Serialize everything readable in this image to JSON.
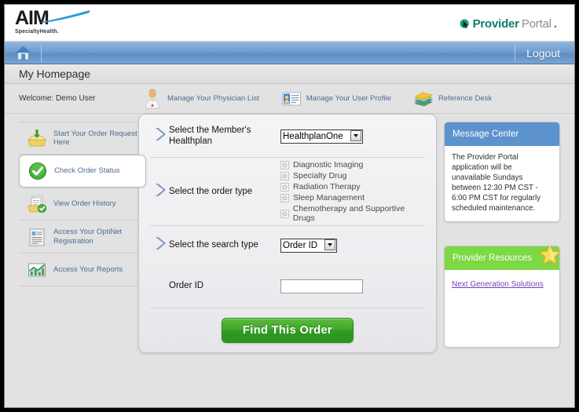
{
  "header": {
    "logo_main": "AIM",
    "logo_sub": "SpecialtyHealth.",
    "portal_brand_1": "Provider",
    "portal_brand_2": "Portal",
    "portal_brand_dot": ".",
    "cursor_icon": "cursor-arrow-icon"
  },
  "nav": {
    "home_icon": "home-icon",
    "logout_label": "Logout"
  },
  "breadcrumb": {
    "title": "My Homepage"
  },
  "welcome": {
    "greeting": "Welcome: Demo User",
    "quicklinks": [
      {
        "label": "Manage Your Physician List",
        "icon": "physician-icon"
      },
      {
        "label": "Manage Your User Profile",
        "icon": "id-card-icon"
      },
      {
        "label": "Reference Desk",
        "icon": "books-icon"
      }
    ]
  },
  "sidebar": {
    "items": [
      {
        "label": "Start Your Order Request Here",
        "icon": "inbox-download-icon",
        "active": false
      },
      {
        "label": "Check Order Status",
        "icon": "green-check-icon",
        "active": true
      },
      {
        "label": "View Order History",
        "icon": "folder-documents-icon",
        "active": false
      },
      {
        "label": "Access Your OptiNet Registration",
        "icon": "document-lines-icon",
        "active": false
      },
      {
        "label": "Access Your Reports",
        "icon": "chart-icon",
        "active": false
      }
    ]
  },
  "form": {
    "healthplan": {
      "label": "Select the Member's Healthplan",
      "selected": "HealthplanOne",
      "options": [
        "HealthplanOne"
      ]
    },
    "order_type": {
      "label": "Select the order type",
      "options": [
        "Diagnostic Imaging",
        "Specialty Drug",
        "Radiation Therapy",
        "Sleep Management",
        "Chemotherapy and Supportive Drugs"
      ],
      "selected": ""
    },
    "search_type": {
      "label": "Select the search type",
      "selected": "Order ID",
      "options": [
        "Order ID"
      ]
    },
    "order_id": {
      "label": "Order ID",
      "value": "",
      "placeholder": ""
    },
    "submit_label": "Find This Order"
  },
  "message_center": {
    "title": "Message Center",
    "body": "The Provider Portal application will be unavailable Sundays between 12:30 PM CST - 6:00 PM CST for regularly scheduled maintenance."
  },
  "provider_resources": {
    "title": "Provider Resources",
    "link": "Next Generation Solutions",
    "badge_icon": "star-icon"
  },
  "colors": {
    "nav_blue": "#6f9dd0",
    "message_header": "#5c92cd",
    "resources_header": "#7cd843",
    "button_green": "#3da62a",
    "brand_teal": "#0d7d6d",
    "link_blue": "#4c6b91",
    "link_purple": "#7a3fb5",
    "star_yellow": "#f2d54e"
  }
}
